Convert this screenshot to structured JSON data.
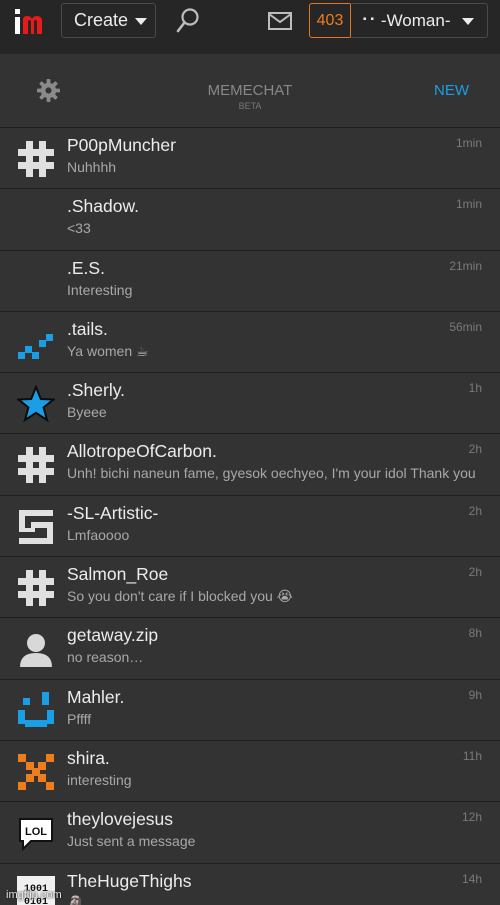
{
  "header": {
    "create_label": "Create",
    "points": "403",
    "username": "⠐⠂-Woman-"
  },
  "chat": {
    "title": "MEMECHAT",
    "subtitle": "BETA",
    "new_label": "NEW"
  },
  "chats": [
    {
      "name": "P00pMuncher",
      "message": "Nuhhhh",
      "time": "1min",
      "avatar": "hash-white-icon"
    },
    {
      "name": ".Shadow.",
      "message": "<33",
      "time": "1min",
      "avatar": "none"
    },
    {
      "name": ".E.S.",
      "message": "Interesting",
      "time": "21min",
      "avatar": "none"
    },
    {
      "name": ".tails.",
      "message": "Ya women ☕",
      "time": "56min",
      "avatar": "blue-zigzag-icon"
    },
    {
      "name": ".Sherly.",
      "message": "Byeee",
      "time": "1h",
      "avatar": "blue-star-icon"
    },
    {
      "name": "AllotropeOfCarbon.",
      "message": "Unh! bichi naneun fame, gyesok oechyeo, I'm your idol Thank you",
      "time": "2h",
      "avatar": "hash-white-icon"
    },
    {
      "name": "-SL-Artistic-",
      "message": "Lmfaoooo",
      "time": "2h",
      "avatar": "swirl-white-icon"
    },
    {
      "name": "Salmon_Roe",
      "message": "So you don't care if I blocked you 😭",
      "time": "2h",
      "avatar": "hash-white-icon"
    },
    {
      "name": "getaway.zip",
      "message": "no reason…",
      "time": "8h",
      "avatar": "default-user-icon"
    },
    {
      "name": "Mahler.",
      "message": "Pffff",
      "time": "9h",
      "avatar": "blue-face-icon"
    },
    {
      "name": "shira.",
      "message": "interesting",
      "time": "11h",
      "avatar": "orange-x-icon"
    },
    {
      "name": "theylovejesus",
      "message": "Just sent a message",
      "time": "12h",
      "avatar": "lol-bubble-icon"
    },
    {
      "name": "TheHugeThighs",
      "message": "🗿",
      "time": "14h",
      "avatar": "binary-icon"
    }
  ],
  "watermark": "imgflip.com",
  "colors": {
    "accent_blue": "#1a9ee6",
    "points_orange": "#ee7d1e",
    "row_bg": "#333333",
    "page_bg": "#262626"
  }
}
